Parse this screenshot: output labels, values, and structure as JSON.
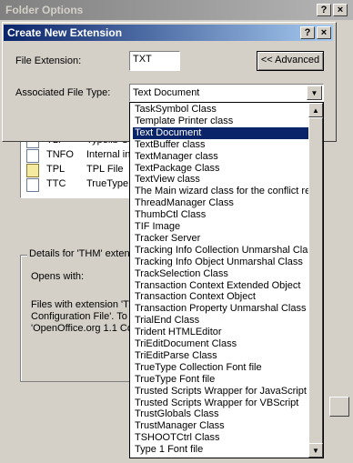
{
  "folder_options": {
    "title": "Folder Options",
    "help_glyph": "?",
    "close_glyph": "×",
    "file_types": [
      {
        "ext": "TLI",
        "type": "Typelib G",
        "icon": "generic-file-icon"
      },
      {
        "ext": "TNFO",
        "type": "Internal in",
        "icon": "info-file-icon"
      },
      {
        "ext": "TPL",
        "type": "TPL File",
        "icon": "template-file-icon"
      },
      {
        "ext": "TTC",
        "type": "TrueType",
        "icon": "font-file-icon"
      }
    ],
    "details_label": "Details for 'THM' exten",
    "opens_with_label": "Opens with:",
    "description_lines": [
      "Files with extension 'TH",
      "Configuration File'.  To",
      "'OpenOffice.org 1.1 Co"
    ]
  },
  "create_new_extension": {
    "title": "Create New Extension",
    "help_glyph": "?",
    "close_glyph": "×",
    "file_extension_label": "File Extension:",
    "file_extension_value": "TXT",
    "advanced_button": "<< Advanced",
    "associated_type_label": "Associated File Type:",
    "associated_type_value": "Text Document",
    "dropdown_arrow": "▼"
  },
  "dropdown": {
    "scroll_up": "▲",
    "scroll_down": "▼",
    "selected": "Text Document",
    "items": [
      "TaskSymbol Class",
      "Template Printer class",
      "Text Document",
      "TextBuffer class",
      "TextManager class",
      "TextPackage Class",
      "TextView class",
      "The Main wizard class for the conflict res",
      "ThreadManager Class",
      "ThumbCtl Class",
      "TIF Image",
      "Tracker Server",
      "Tracking Info Collection Unmarshal Class",
      "Tracking Info Object Unmarshal Class",
      "TrackSelection Class",
      "Transaction Context Extended Object",
      "Transaction Context Object",
      "Transaction Property Unmarshal Class",
      "TrialEnd Class",
      "Trident HTMLEditor",
      "TriEditDocument Class",
      "TriEditParse Class",
      "TrueType Collection Font file",
      "TrueType Font file",
      "Trusted Scripts Wrapper for JavaScript",
      "Trusted Scripts Wrapper for VBScript",
      "TrustGlobals Class",
      "TrustManager Class",
      "TSHOOTCtrl Class",
      "Type 1 Font file"
    ]
  }
}
